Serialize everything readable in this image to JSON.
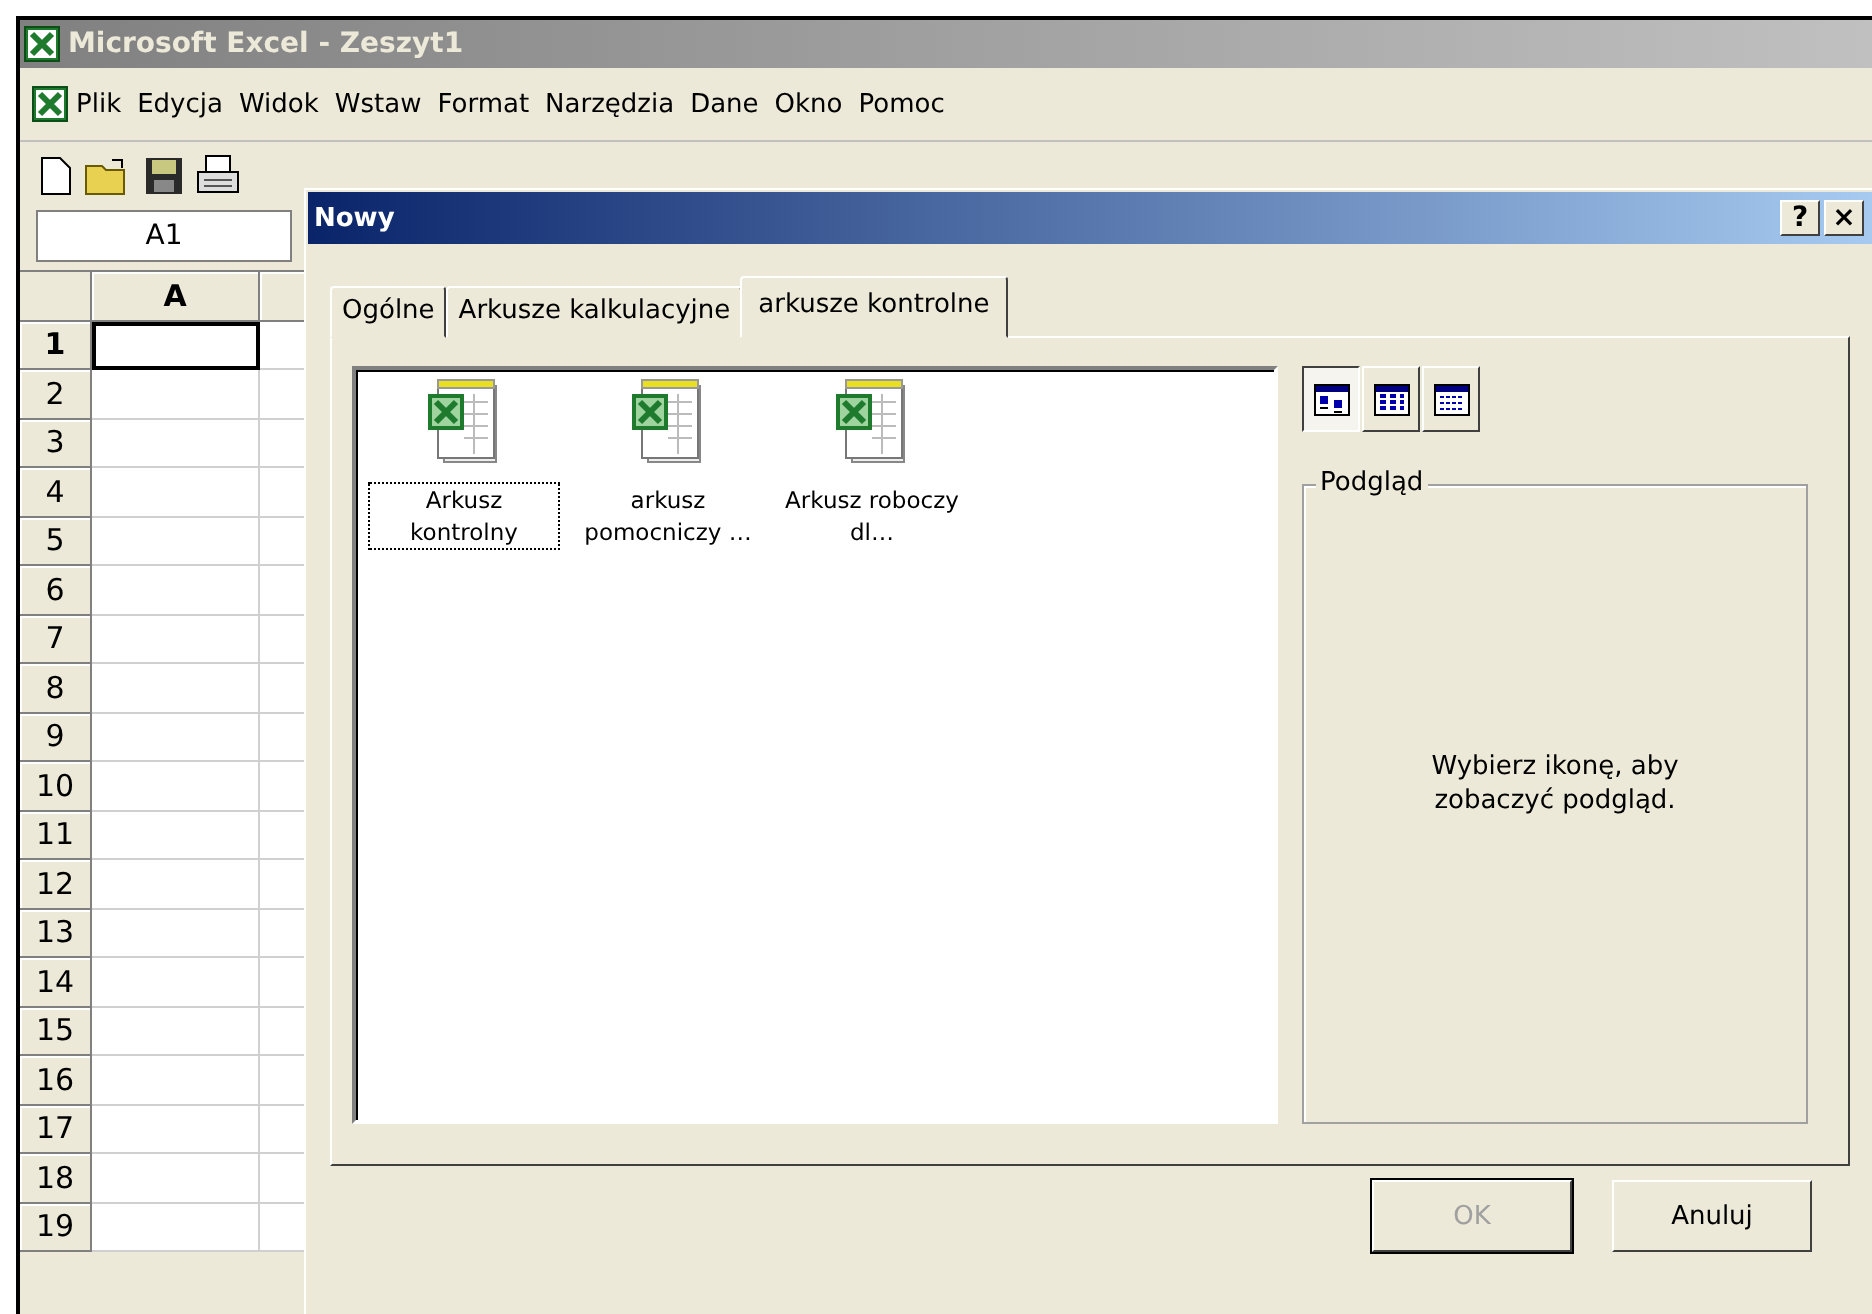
{
  "app_window": {
    "title": "Microsoft Excel - Zeszyt1"
  },
  "menu": [
    "Plik",
    "Edycja",
    "Widok",
    "Wstaw",
    "Format",
    "Narzędzia",
    "Dane",
    "Okno",
    "Pomoc"
  ],
  "name_box": "A1",
  "sheet": {
    "columns": [
      "A"
    ],
    "rows": [
      {
        "label": "1",
        "selected": true
      },
      {
        "label": "2",
        "selected": false
      },
      {
        "label": "3",
        "selected": false
      },
      {
        "label": "4",
        "selected": false
      },
      {
        "label": "5",
        "selected": false
      },
      {
        "label": "6",
        "selected": false
      },
      {
        "label": "7",
        "selected": false
      },
      {
        "label": "8",
        "selected": false
      },
      {
        "label": "9",
        "selected": false
      },
      {
        "label": "10",
        "selected": false
      },
      {
        "label": "11",
        "selected": false
      },
      {
        "label": "12",
        "selected": false
      },
      {
        "label": "13",
        "selected": false
      },
      {
        "label": "14",
        "selected": false
      },
      {
        "label": "15",
        "selected": false
      },
      {
        "label": "16",
        "selected": false
      },
      {
        "label": "17",
        "selected": false
      },
      {
        "label": "18",
        "selected": false
      },
      {
        "label": "19",
        "selected": false
      }
    ]
  },
  "dialog": {
    "title": "Nowy",
    "help": "?",
    "close": "×",
    "tabs": [
      {
        "label": "Ogólne",
        "selected": false
      },
      {
        "label": "Arkusze kalkulacyjne",
        "selected": false
      },
      {
        "label": "arkusze kontrolne",
        "selected": true
      }
    ],
    "templates": [
      {
        "label": "Arkusz kontrolny",
        "selected": true
      },
      {
        "label": "arkusz pomocniczy …",
        "selected": false
      },
      {
        "label": "Arkusz roboczy dl…",
        "selected": false
      }
    ],
    "views": [
      {
        "kind": "large",
        "selected": true
      },
      {
        "kind": "list",
        "selected": false
      },
      {
        "kind": "details",
        "selected": false
      }
    ],
    "preview": {
      "title": "Podgląd",
      "message": "Wybierz ikonę, aby zobaczyć podgląd."
    },
    "buttons": [
      {
        "label": "OK",
        "disabled": true
      },
      {
        "label": "Anuluj",
        "disabled": false
      }
    ]
  }
}
